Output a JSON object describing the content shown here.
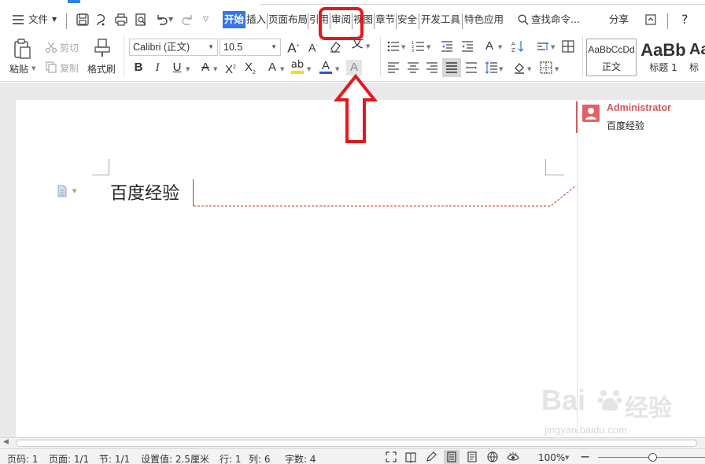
{
  "menubar": {
    "file_label": "文件",
    "tabs": [
      {
        "label": "开始",
        "active": true
      },
      {
        "label": "插入"
      },
      {
        "label": "页面布局"
      },
      {
        "label": "引用"
      },
      {
        "label": "审阅"
      },
      {
        "label": "视图"
      },
      {
        "label": "章节"
      },
      {
        "label": "安全"
      },
      {
        "label": "开发工具"
      },
      {
        "label": "特色应用"
      }
    ],
    "search_label": "查找命令...",
    "share_label": "分享",
    "help_label": "?"
  },
  "ribbon": {
    "paste_label": "粘贴",
    "cut_label": "剪切",
    "copy_label": "复制",
    "format_painter_label": "格式刷",
    "font_name": "Calibri (正文)",
    "font_size": "10.5",
    "phonetic_label": "wén"
  },
  "styles": [
    {
      "sample": "AaBbCcDd",
      "name": "正文",
      "selected": true
    },
    {
      "sample": "AaBb",
      "name": "标题 1"
    },
    {
      "sample": "Aa",
      "name": "标"
    }
  ],
  "document": {
    "text": "百度经验"
  },
  "comment": {
    "author": "Administrator",
    "text": "百度经验"
  },
  "statusbar": {
    "page_no": "页码: 1",
    "pages": "页面: 1/1",
    "section": "节: 1/1",
    "setting": "设置值: 2.5厘米",
    "row": "行: 1",
    "col": "列: 6",
    "word_count": "字数: 4",
    "zoom": "100%"
  },
  "watermark": {
    "brand_latin": "Bai",
    "brand_cn": "经验",
    "url": "jingyan.baidu.com"
  },
  "colors": {
    "accent_blue": "#3476f0",
    "annotation_red": "#e8161b",
    "comment_red": "#d05a5a"
  }
}
